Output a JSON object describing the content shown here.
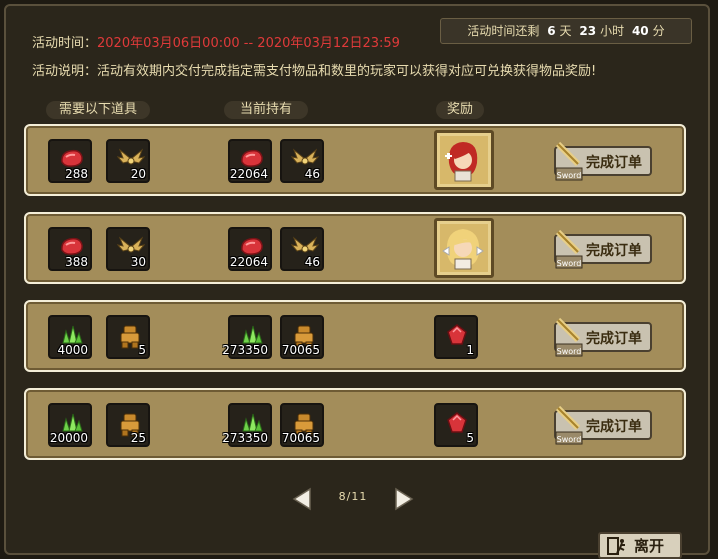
{
  "header": {
    "time_label": "活动时间：",
    "time_value": "2020年03月06日00:00 -- 2020年03月12日23:59",
    "desc_label": "活动说明：",
    "desc_value": "活动有效期内交付完成指定需支付物品和数里的玩家可以获得对应可兑换获得物品奖励!",
    "remain_label": "活动时间还剩",
    "remain_days": "6",
    "days_unit": "天",
    "remain_hours": "23",
    "hours_unit": "小时",
    "remain_minutes": "40",
    "minutes_unit": "分"
  },
  "columns": {
    "required": "需要以下道具",
    "held": "当前持有",
    "reward": "奖励"
  },
  "rows": [
    {
      "req1": "288",
      "req2": "20",
      "have1": "22064",
      "have2": "46",
      "reward_icon": "red-hair-character-portrait",
      "action": "完成订单",
      "action_sub": "Sword"
    },
    {
      "req1": "388",
      "req2": "30",
      "have1": "22064",
      "have2": "46",
      "reward_icon": "blonde-character-portrait",
      "action": "完成订单",
      "action_sub": "Sword"
    },
    {
      "req1": "4000",
      "req2": "5",
      "have1": "273350",
      "have2": "70065",
      "reward": "1",
      "reward_icon": "red-gem-icon",
      "action": "完成订单",
      "action_sub": "Sword"
    },
    {
      "req1": "20000",
      "req2": "25",
      "have1": "273350",
      "have2": "70065",
      "reward": "5",
      "reward_icon": "red-gem-icon",
      "action": "完成订单",
      "action_sub": "Sword"
    }
  ],
  "pager": {
    "label": "8/11"
  },
  "leave_label": "离开",
  "colors": {
    "accent_red": "#e03a3a",
    "row_bg": "#a38d5a"
  }
}
